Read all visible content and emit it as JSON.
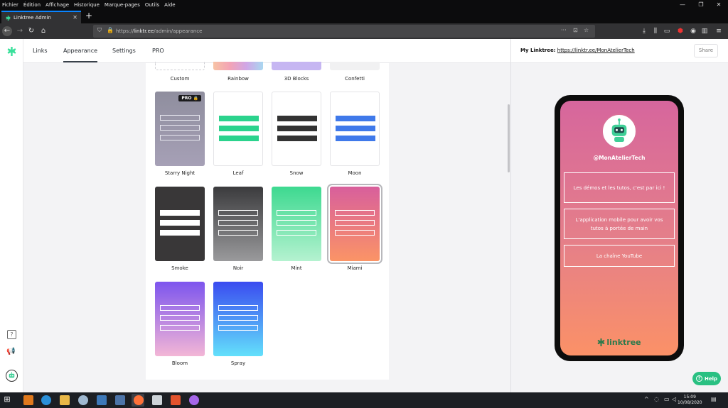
{
  "browser": {
    "menu_items": [
      "Fichier",
      "Édition",
      "Affichage",
      "Historique",
      "Marque-pages",
      "Outils",
      "Aide"
    ],
    "tab_title": "Linktree Admin",
    "url_prefix": "https://",
    "url_host": "linktr.ee",
    "url_path": "/admin/appearance"
  },
  "nav": {
    "tabs": [
      "Links",
      "Appearance",
      "Settings",
      "PRO"
    ]
  },
  "themes": {
    "top_row_labels": [
      "Custom",
      "Rainbow",
      "3D Blocks",
      "Confetti"
    ],
    "pro_badge": "PRO",
    "tiles": [
      {
        "label": "Starry Night",
        "bg": "linear-gradient(180deg,#8f8e9e,#a6a0b6)",
        "bar": "outline",
        "bar_color": "#e6e6ee",
        "pro": true
      },
      {
        "label": "Leaf",
        "bg": "#ffffff",
        "bar": "solid",
        "bar_color": "#2bd38d",
        "bordered": true
      },
      {
        "label": "Snow",
        "bg": "#ffffff",
        "bar": "solid",
        "bar_color": "#333333",
        "bordered": true
      },
      {
        "label": "Moon",
        "bg": "#ffffff",
        "bar": "solid",
        "bar_color": "#3f79ea",
        "bordered": true
      },
      {
        "label": "Smoke",
        "bg": "#393738",
        "bar": "solid",
        "bar_color": "#ffffff"
      },
      {
        "label": "Noir",
        "bg": "linear-gradient(180deg,#3b3b3d,#9a9a9c)",
        "bar": "outline",
        "bar_color": "#ffffff"
      },
      {
        "label": "Mint",
        "bg": "linear-gradient(180deg,#3dd990,#b5f2d0)",
        "bar": "outline",
        "bar_color": "#ffffff"
      },
      {
        "label": "Miami",
        "bg": "linear-gradient(180deg,#d85f9c,#fb9466)",
        "bar": "outline",
        "bar_color": "#ffffff",
        "selected": true
      },
      {
        "label": "Bloom",
        "bg": "linear-gradient(180deg,#7d55ee,#f3b6d6)",
        "bar": "outline",
        "bar_color": "#ffffff"
      },
      {
        "label": "Spray",
        "bg": "linear-gradient(180deg,#3a4bf0,#63e0fb)",
        "bar": "outline",
        "bar_color": "#ffffff"
      }
    ]
  },
  "preview": {
    "header_label": "My Linktree:",
    "header_url": "https://linktr.ee/MonAtelierTech",
    "share_label": "Share",
    "handle": "@MonAtelierTech",
    "links": [
      "Les démos et les tutos, c'est par ici !",
      "L'application mobile pour avoir vos tutos à portée de main",
      "La chaîne YouTube"
    ],
    "footer_brand": "linktree"
  },
  "help": {
    "label": "Help"
  },
  "taskbar": {
    "time": "15:09",
    "date": "10/08/2020"
  },
  "colors": {
    "brand_green": "#39e09b",
    "help_green": "#29c082",
    "selected_ring": "#b8b8bc"
  }
}
